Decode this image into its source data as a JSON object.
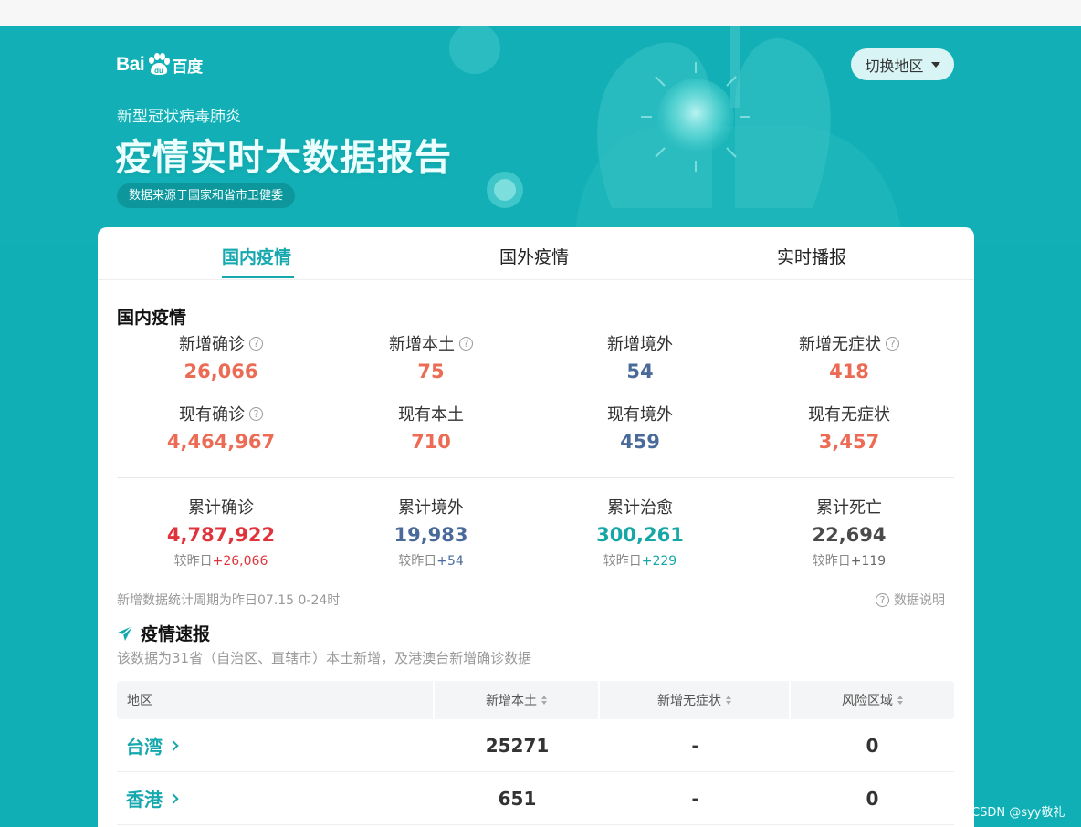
{
  "brand": {
    "logo_text": "Bai",
    "logo_cn": "百度"
  },
  "hero": {
    "subtitle": "新型冠状病毒肺炎",
    "title": "疫情实时大数据报告",
    "source_pill": "数据来源于国家和省市卫健委",
    "region_button": "切换地区"
  },
  "tabs": [
    {
      "label": "国内疫情",
      "active": true
    },
    {
      "label": "国外疫情",
      "active": false
    },
    {
      "label": "实时播报",
      "active": false
    }
  ],
  "domestic": {
    "title": "国内疫情",
    "row1": [
      {
        "label": "新增确诊",
        "value": "26,066",
        "help": true,
        "color": "#ec6b55"
      },
      {
        "label": "新增本土",
        "value": "75",
        "help": true,
        "color": "#ec6b55"
      },
      {
        "label": "新增境外",
        "value": "54",
        "help": false,
        "color": "#4a6b9a"
      },
      {
        "label": "新增无症状",
        "value": "418",
        "help": true,
        "color": "#ec6b55"
      }
    ],
    "row2": [
      {
        "label": "现有确诊",
        "value": "4,464,967",
        "help": true,
        "color": "#ec6b55"
      },
      {
        "label": "现有本土",
        "value": "710",
        "help": false,
        "color": "#ec6b55"
      },
      {
        "label": "现有境外",
        "value": "459",
        "help": false,
        "color": "#4a6b9a"
      },
      {
        "label": "现有无症状",
        "value": "3,457",
        "help": false,
        "color": "#ec6b55"
      }
    ],
    "row3": [
      {
        "label": "累计确诊",
        "value": "4,787,922",
        "delta_prefix": "较昨日",
        "delta": "+26,066",
        "color": "#e0343c",
        "delta_color": "#e0343c"
      },
      {
        "label": "累计境外",
        "value": "19,983",
        "delta_prefix": "较昨日",
        "delta": "+54",
        "color": "#4a6b9a",
        "delta_color": "#4a6b9a"
      },
      {
        "label": "累计治愈",
        "value": "300,261",
        "delta_prefix": "较昨日",
        "delta": "+229",
        "color": "#17a6a6",
        "delta_color": "#17a6a6"
      },
      {
        "label": "累计死亡",
        "value": "22,694",
        "delta_prefix": "较昨日",
        "delta": "+119",
        "color": "#4a4a4a",
        "delta_color": "#666666"
      }
    ],
    "period_note": "新增数据统计周期为昨日07.15 0-24时",
    "explain_link": "数据说明"
  },
  "kuaibao": {
    "title": "疫情速报",
    "subtitle": "该数据为31省（自治区、直辖市）本土新增，及港澳台新增确诊数据",
    "columns": [
      "地区",
      "新增本土",
      "新增无症状",
      "风险区域"
    ],
    "rows": [
      {
        "region": "台湾",
        "local": "25271",
        "asymptomatic": "-",
        "risk": "0"
      },
      {
        "region": "香港",
        "local": "651",
        "asymptomatic": "-",
        "risk": "0"
      }
    ]
  },
  "watermark": "CSDN @syy敬礼",
  "icon_names": [
    "baidu-paw-icon",
    "caret-down-icon",
    "help-icon",
    "paper-plane-icon",
    "sort-icon",
    "chevron-right-icon"
  ]
}
